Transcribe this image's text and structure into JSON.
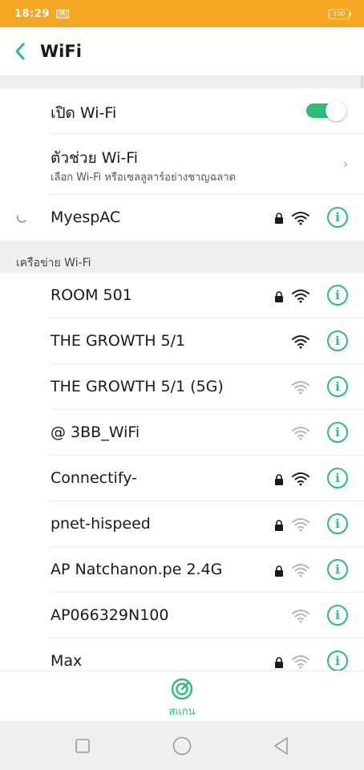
{
  "status_bar": {
    "time": "18:29",
    "battery": "100"
  },
  "header": {
    "title": "WiFi"
  },
  "settings": {
    "wifi_toggle_label": "เปิด Wi-Fi",
    "wifi_enabled": true,
    "assistant_title": "ตัวช่วย Wi-Fi",
    "assistant_subtitle": "เลือก Wi-Fi หรือเซลลูลาร์อย่างชาญฉลาด"
  },
  "connected_network": {
    "name": "MyespAC",
    "secured": true,
    "signal": "strong",
    "status": "connecting"
  },
  "section": {
    "label": "เครือข่าย Wi-Fi"
  },
  "networks": [
    {
      "name": "ROOM 501",
      "secured": true,
      "signal": "strong"
    },
    {
      "name": "THE GROWTH 5/1",
      "secured": false,
      "signal": "strong"
    },
    {
      "name": "THE GROWTH 5/1 (5G)",
      "secured": false,
      "signal": "weak"
    },
    {
      "name": "@ 3BB_WiFi",
      "secured": false,
      "signal": "weak"
    },
    {
      "name": "Connectify-",
      "secured": true,
      "signal": "strong"
    },
    {
      "name": "pnet-hispeed",
      "secured": true,
      "signal": "weak"
    },
    {
      "name": "AP Natchanon.pe  2.4G",
      "secured": true,
      "signal": "weak"
    },
    {
      "name": "AP066329N100",
      "secured": false,
      "signal": "weak"
    },
    {
      "name": "Max",
      "secured": true,
      "signal": "weak"
    }
  ],
  "scan": {
    "label": "สแกน"
  },
  "colors": {
    "accent": "#2ebd78",
    "status_bar": "#f5a623",
    "band": "#efefef"
  },
  "icons": {
    "back": "chevron-left-icon",
    "lock": "lock-icon",
    "wifi": "wifi-signal-icon",
    "info": "info-icon",
    "scan": "radar-scan-icon"
  }
}
